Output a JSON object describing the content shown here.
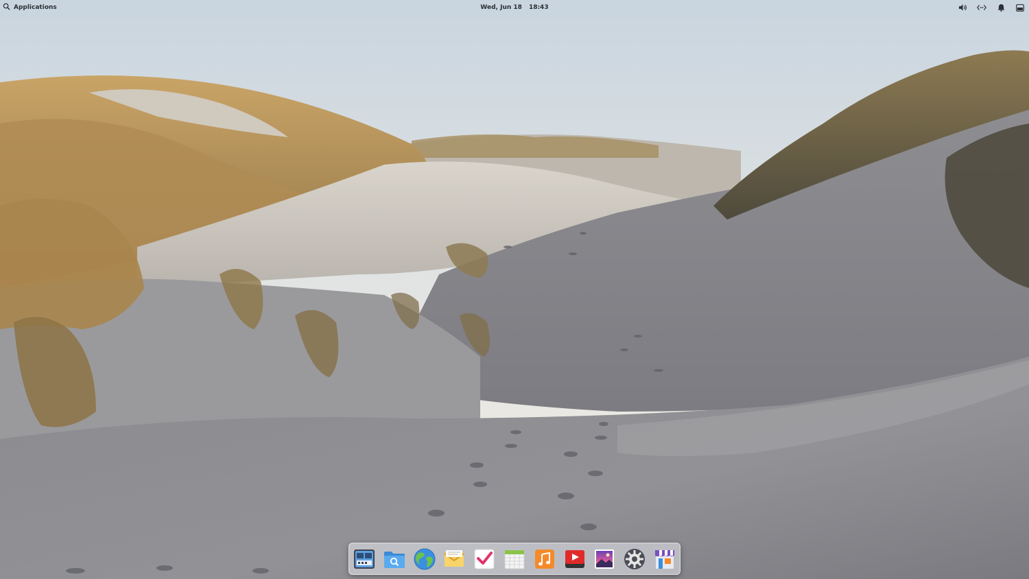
{
  "panel": {
    "applications_label": "Applications",
    "date": "Wed, Jun 18",
    "time": "18:43",
    "text_color": "#2b2f36",
    "indicators": [
      {
        "name": "volume-icon"
      },
      {
        "name": "network-icon"
      },
      {
        "name": "notifications-icon"
      },
      {
        "name": "session-icon"
      }
    ]
  },
  "wallpaper": {
    "description_name": "sand-dunes-wallpaper"
  },
  "dock": {
    "items": [
      {
        "name": "multitasking-view",
        "icon": "multitasking-icon"
      },
      {
        "name": "files",
        "icon": "files-icon"
      },
      {
        "name": "web-browser",
        "icon": "browser-icon"
      },
      {
        "name": "mail",
        "icon": "mail-icon"
      },
      {
        "name": "tasks",
        "icon": "tasks-icon"
      },
      {
        "name": "calendar",
        "icon": "calendar-icon"
      },
      {
        "name": "music",
        "icon": "music-icon"
      },
      {
        "name": "videos",
        "icon": "videos-icon"
      },
      {
        "name": "photos",
        "icon": "photos-icon"
      },
      {
        "name": "system-settings",
        "icon": "settings-icon"
      },
      {
        "name": "app-center",
        "icon": "app-center-icon"
      }
    ]
  }
}
